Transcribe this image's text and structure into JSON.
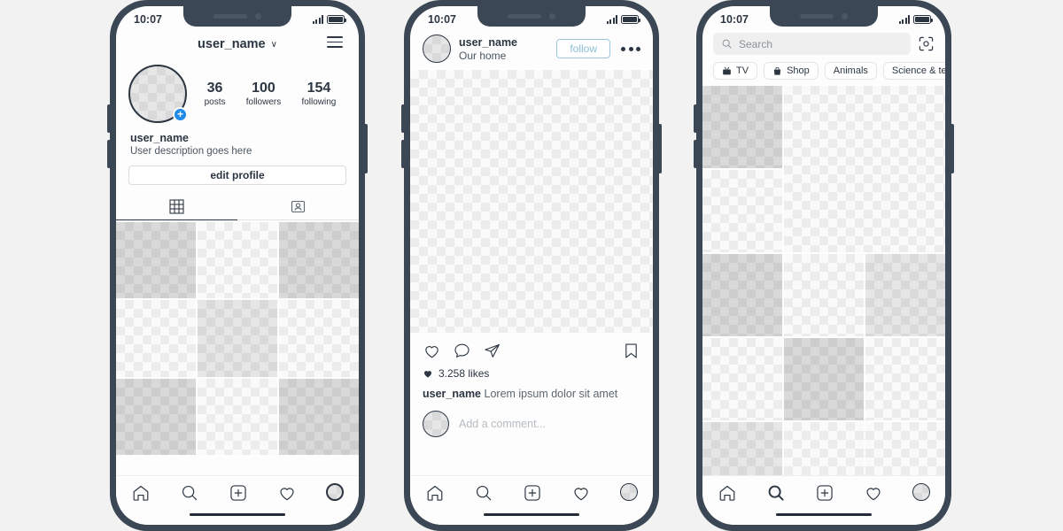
{
  "status_bar": {
    "time": "10:07",
    "signal_icon": "signal-bars-icon",
    "battery_icon": "battery-icon"
  },
  "phone1": {
    "header": {
      "username": "user_name",
      "chevron": "∨",
      "menu_icon": "hamburger-menu-icon"
    },
    "avatar": {
      "name": "profile-avatar",
      "badge": "+"
    },
    "stats": [
      {
        "num": "36",
        "label": "posts"
      },
      {
        "num": "100",
        "label": "followers"
      },
      {
        "num": "154",
        "label": "following"
      }
    ],
    "bio": {
      "name": "user_name",
      "description": "User description goes here"
    },
    "edit_button": "edit profile",
    "tabs": [
      {
        "name": "grid-tab",
        "icon": "grid-icon",
        "active": true
      },
      {
        "name": "tagged-tab",
        "icon": "person-card-icon",
        "active": false
      }
    ],
    "grid_cells": [
      "dk",
      "lt",
      "dk",
      "lt",
      "md",
      "lt",
      "dk",
      "lt",
      "dk"
    ],
    "nav": [
      {
        "name": "home",
        "icon": "home-icon"
      },
      {
        "name": "search",
        "icon": "search-icon"
      },
      {
        "name": "add",
        "icon": "plus-square-icon"
      },
      {
        "name": "activity",
        "icon": "heart-icon"
      },
      {
        "name": "profile",
        "icon": "avatar-icon"
      }
    ]
  },
  "phone2": {
    "post": {
      "avatar": "post-avatar",
      "username": "user_name",
      "location": "Our home",
      "follow_label": "follow",
      "more_icon": "more-options-icon",
      "image": "post-image-placeholder"
    },
    "actions": [
      {
        "name": "like",
        "icon": "heart-icon"
      },
      {
        "name": "comment",
        "icon": "comment-icon"
      },
      {
        "name": "share",
        "icon": "paper-plane-icon"
      },
      {
        "name": "save",
        "icon": "bookmark-icon"
      }
    ],
    "likes": "3.258 likes",
    "likes_icon": "heart-filled-icon",
    "caption_user": "user_name",
    "caption_text": "Lorem ipsum dolor sit amet",
    "comment_placeholder": "Add a comment...",
    "nav": [
      {
        "name": "home",
        "icon": "home-icon"
      },
      {
        "name": "search",
        "icon": "search-icon"
      },
      {
        "name": "add",
        "icon": "plus-square-icon"
      },
      {
        "name": "activity",
        "icon": "heart-icon"
      },
      {
        "name": "profile",
        "icon": "avatar-icon"
      }
    ]
  },
  "phone3": {
    "search": {
      "placeholder": "Search",
      "icon": "search-icon",
      "camera_icon": "camera-scan-icon"
    },
    "chips": [
      {
        "label": "TV",
        "icon": "tv-icon"
      },
      {
        "label": "Shop",
        "icon": "shopping-bag-icon"
      },
      {
        "label": "Animals",
        "icon": ""
      },
      {
        "label": "Science & tec",
        "icon": ""
      }
    ],
    "explore_tiles": [
      "dk",
      "lt",
      "lt",
      "dk",
      "md",
      "md",
      "dk",
      "dk",
      "md",
      "lt"
    ],
    "nav": [
      {
        "name": "home",
        "icon": "home-icon"
      },
      {
        "name": "search",
        "icon": "search-icon",
        "active": true
      },
      {
        "name": "add",
        "icon": "plus-square-icon"
      },
      {
        "name": "activity",
        "icon": "heart-icon"
      },
      {
        "name": "profile",
        "icon": "avatar-icon"
      }
    ]
  },
  "colors": {
    "frame": "#3b4755",
    "background": "#f2f2f2",
    "accent_blue": "#1e8ae8",
    "follow_blue": "#8dbdd8",
    "ink": "#2c3642"
  }
}
